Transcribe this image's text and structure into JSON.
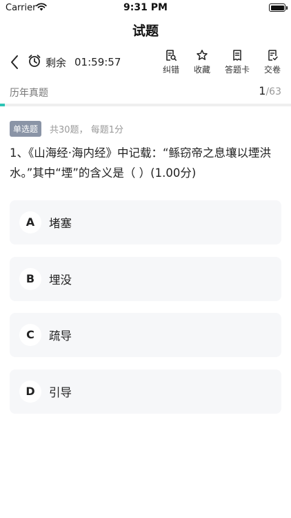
{
  "status_bar": {
    "carrier": "Carrier",
    "time": "9:31 PM"
  },
  "nav": {
    "title": "试题"
  },
  "toolbar": {
    "timer_label": "剩余",
    "timer_value": "01:59:57",
    "actions": [
      {
        "label": "纠错",
        "icon": "error-report-icon"
      },
      {
        "label": "收藏",
        "icon": "star-icon"
      },
      {
        "label": "答题卡",
        "icon": "answer-card-icon"
      },
      {
        "label": "交卷",
        "icon": "submit-icon"
      }
    ]
  },
  "sub_header": {
    "paper_type": "历年真题",
    "current": "1",
    "total": "/63",
    "progress": 0.0159
  },
  "question": {
    "type_badge": "单选题",
    "info": "共30题， 每题1分",
    "stem": "1、《山海经·海内经》中记载：“鲧窃帝之息壤以堙洪水。”其中“堙”的含义是（ ）(1.00分)"
  },
  "options": [
    {
      "letter": "A",
      "text": "堵塞"
    },
    {
      "letter": "B",
      "text": "埋没"
    },
    {
      "letter": "C",
      "text": "疏导"
    },
    {
      "letter": "D",
      "text": "引导"
    }
  ],
  "colors": {
    "accent": "#2ec4b6",
    "badge": "#8a94a6",
    "option_bg": "#f6f7f9"
  }
}
